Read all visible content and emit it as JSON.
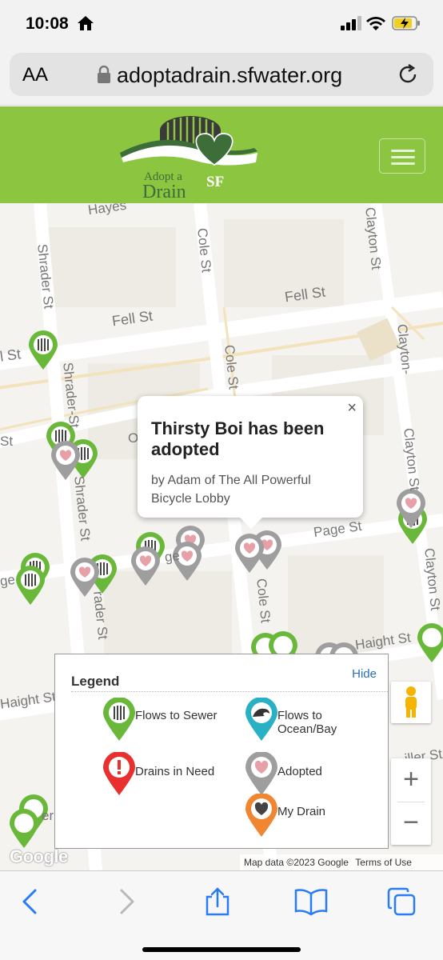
{
  "status": {
    "time": "10:08"
  },
  "browser": {
    "text_size_label": "AA",
    "url": "adoptadrain.sfwater.org"
  },
  "site": {
    "logo_adopt": "Adopt a",
    "logo_drain": "Drain",
    "logo_sf": "SF"
  },
  "map": {
    "streets": {
      "hayes": "Hayes",
      "shrader_top": "Shrader St",
      "cole_top": "Cole St",
      "clayton_top": "Clayton St",
      "fell_right": "Fell St",
      "fell_left": "Fell St",
      "fell_edge": "l St",
      "shrader_mid": "Shrader-St",
      "cole_mid": "Cole St",
      "clayton_mid": "Clayton-",
      "oak_edge": "St",
      "o_label": "O",
      "clayton_lower": "Clayton St",
      "shrader_lower": "Shrader St",
      "page": "Page St",
      "page_left": "ge",
      "page_mid": "ge",
      "clayton_bottom": "Clayton St",
      "cole_lower": "Cole St",
      "shrader_bottom": "rader St",
      "haight_right": "Haight St",
      "haight_left": "Haight St",
      "bottom_er": "er",
      "bottom_right": "iller St"
    },
    "popup": {
      "close": "×",
      "title": "Thirsty Boi has been adopted",
      "subtitle": "by Adam of The All Powerful Bicycle Lobby"
    },
    "legend": {
      "title": "Legend",
      "hide": "Hide",
      "items": [
        {
          "label": "Flows to Sewer",
          "color": "#6ab839",
          "icon": "sewer-grate-icon"
        },
        {
          "label": "Flows to Ocean/Bay",
          "color": "#2ab0c4",
          "icon": "wave-icon"
        },
        {
          "label": "Drains in Need",
          "color": "#e8302f",
          "icon": "exclamation-icon"
        },
        {
          "label": "Adopted",
          "color": "#9e9e9e",
          "icon": "heart-icon"
        },
        {
          "label": "My Drain",
          "color": "#f08532",
          "icon": "heart-icon"
        }
      ]
    },
    "controls": {
      "zoom_in": "+",
      "zoom_out": "−"
    },
    "google_logo": "Google",
    "attribution": {
      "data": "Map data ©2023 Google",
      "terms": "Terms of Use"
    }
  }
}
